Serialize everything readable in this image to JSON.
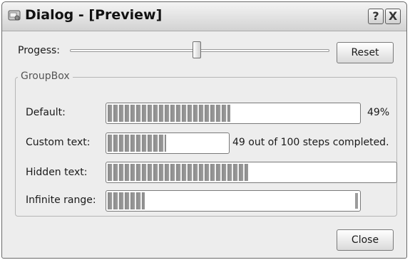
{
  "window": {
    "title": "Dialog - [Preview]",
    "help_glyph": "?",
    "close_glyph": "X"
  },
  "slider": {
    "label": "Progess:",
    "value_fraction": 0.49
  },
  "reset_button": {
    "label": "Reset"
  },
  "groupbox": {
    "title": "GroupBox",
    "rows": [
      {
        "label": "Default:",
        "progress_fraction": 0.49,
        "value_text": "49%"
      },
      {
        "label": "Custom text:",
        "progress_fraction": 0.49,
        "value_text": "49 out of 100 steps completed."
      },
      {
        "label": "Hidden text:",
        "progress_fraction": 0.49
      },
      {
        "label": "Infinite range:",
        "indeterminate": true
      }
    ]
  },
  "close_button": {
    "label": "Close"
  },
  "colors": {
    "window_bg": "#ededed",
    "bar_chunk": "#8a8a8a"
  }
}
